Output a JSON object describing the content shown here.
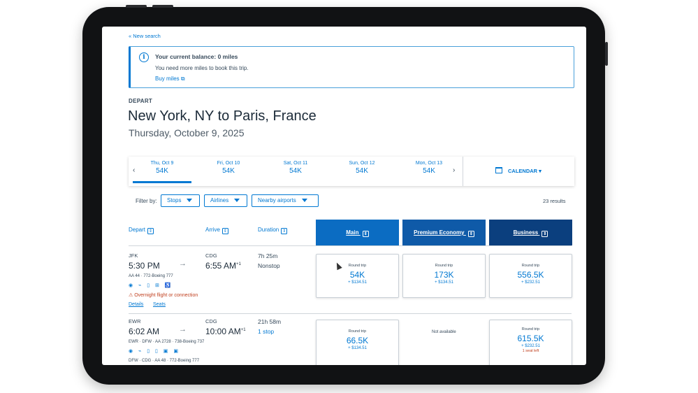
{
  "nav": {
    "new_search": "« New search"
  },
  "balance": {
    "title": "Your current balance: 0 miles",
    "message": "You need more miles to book this trip.",
    "buy_miles": "Buy miles ⧉"
  },
  "trip": {
    "depart_label": "DEPART",
    "route": "New York, NY to Paris, France",
    "date": "Thursday, October 9, 2025"
  },
  "date_strip": {
    "dates": [
      {
        "day": "Thu, Oct 9",
        "miles": "54K",
        "selected": true
      },
      {
        "day": "Fri, Oct 10",
        "miles": "54K"
      },
      {
        "day": "Sat, Oct 11",
        "miles": "54K"
      },
      {
        "day": "Sun, Oct 12",
        "miles": "54K"
      },
      {
        "day": "Mon, Oct 13",
        "miles": "54K"
      }
    ],
    "calendar_label": "CALENDAR ▾"
  },
  "filters": {
    "label": "Filter by:",
    "stops": "Stops",
    "airlines": "Airlines",
    "nearby": "Nearby airports",
    "results": "23 results"
  },
  "columns": {
    "depart": "Depart",
    "arrive": "Arrive",
    "duration": "Duration"
  },
  "cabins": [
    {
      "name": "Main",
      "color": "#0b6cc2"
    },
    {
      "name": "Premium Economy",
      "color": "#0f5aa8"
    },
    {
      "name": "Business",
      "color": "#0b3f7e"
    }
  ],
  "flights": [
    {
      "from": "JFK",
      "depart_time": "5:30 PM",
      "to": "CDG",
      "arrive_time": "6:55 AM",
      "day_offset": "+1",
      "duration": "7h 25m",
      "stops": "Nonstop",
      "equipment": "AA 44  ·  772-Boeing 777",
      "amenities": "◉ ⌁ ▯ ⊞ ♿",
      "warning": "⚠ Overnight flight or connection",
      "details": "Details",
      "seats": "Seats",
      "fares": [
        {
          "label": "Round trip",
          "miles": "54K",
          "tax": "+ $134.51"
        },
        {
          "label": "Round trip",
          "miles": "173K",
          "tax": "+ $134.51"
        },
        {
          "label": "Round trip",
          "miles": "556.5K",
          "tax": "+ $232.51"
        }
      ]
    },
    {
      "from": "EWR",
      "depart_time": "6:02 AM",
      "to": "CDG",
      "arrive_time": "10:00 AM",
      "day_offset": "+1",
      "duration": "21h 58m",
      "stops": "1 stop",
      "equipment": "EWR · DFW  ·  AA 2728  ·  738-Boeing 737",
      "amenities": "◉ ⌁ ▯ ▯ ▣ ▣",
      "equipment2": "DFW · CDG  ·  AA 48  ·  772-Boeing 777",
      "fares": [
        {
          "label": "Round trip",
          "miles": "66.5K",
          "tax": "+ $134.51"
        },
        {
          "label": "Not available"
        },
        {
          "label": "Round trip",
          "miles": "615.5K",
          "tax": "+ $232.51",
          "seats_left": "1 seat left"
        }
      ]
    }
  ]
}
